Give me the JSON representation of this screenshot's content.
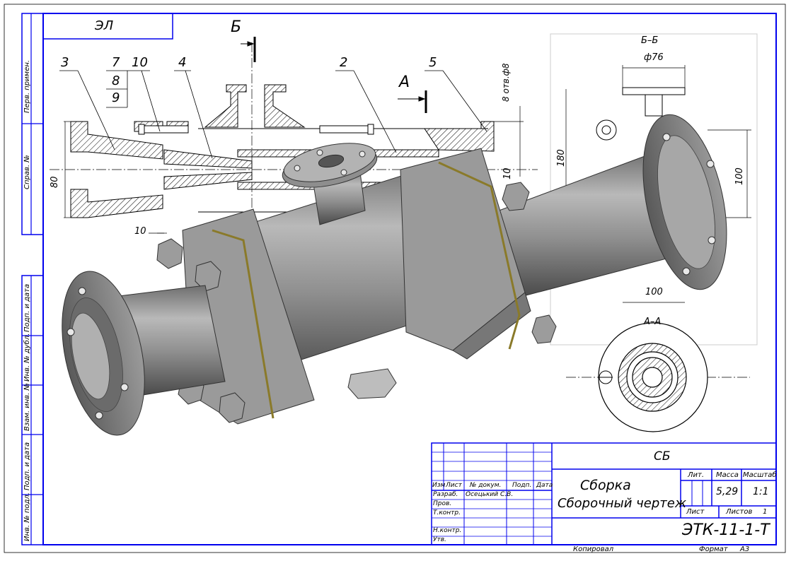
{
  "stamp": {
    "code": "ЭЛ"
  },
  "section_marks": {
    "b_top": "Б",
    "a": "А",
    "b_section": "Б–Б",
    "a_section": "А–А"
  },
  "dimensions": {
    "holes": "8 отв.ф8",
    "d80": "80",
    "d10": "10",
    "d10b": "10",
    "d180": "180",
    "d100_vert": "100",
    "d100_horz": "100",
    "dia76": "ф76"
  },
  "leaders": {
    "n3": "3",
    "n7": "7",
    "n8": "8",
    "n9": "9",
    "n10": "10",
    "n4": "4",
    "n2": "2",
    "n5": "5"
  },
  "side_stamps": [
    "Перв. примен.",
    "Справ. №",
    "Подп. и дата",
    "Инв. № дубл.",
    "Взам. инв. №",
    "Подп. и дата",
    "Инв. № подл."
  ],
  "title_block": {
    "doc_type": "СБ",
    "name_line1": "Сборка",
    "name_line2": "Сборочный чертеж",
    "col_headers": {
      "izm": "Изм",
      "list": "Лист",
      "docum": "№ докум.",
      "podp": "Подп.",
      "data": "Дата"
    },
    "rows": {
      "razrab": "Разраб.",
      "prov": "Пров.",
      "tkontr": "Т.контр.",
      "nkontr": "Н.контр.",
      "utv": "Утв."
    },
    "developer": "Осецький С.В.",
    "lit_label": "Лит.",
    "mass_label": "Масса",
    "scale_label": "Масштаб",
    "mass_value": "5,29",
    "scale_value": "1:1",
    "sheet_label": "Лист",
    "sheets_label": "Листов",
    "sheets_value": "1",
    "designation": "ЭТК-11-1-Т"
  },
  "footer": {
    "copied": "Копировал",
    "format": "Формат",
    "format_value": "А3"
  },
  "colors": {
    "frame": "#0000ee",
    "metal": "#8c8c8c",
    "hatch": "#000000",
    "seal": "#8a7a2a"
  }
}
